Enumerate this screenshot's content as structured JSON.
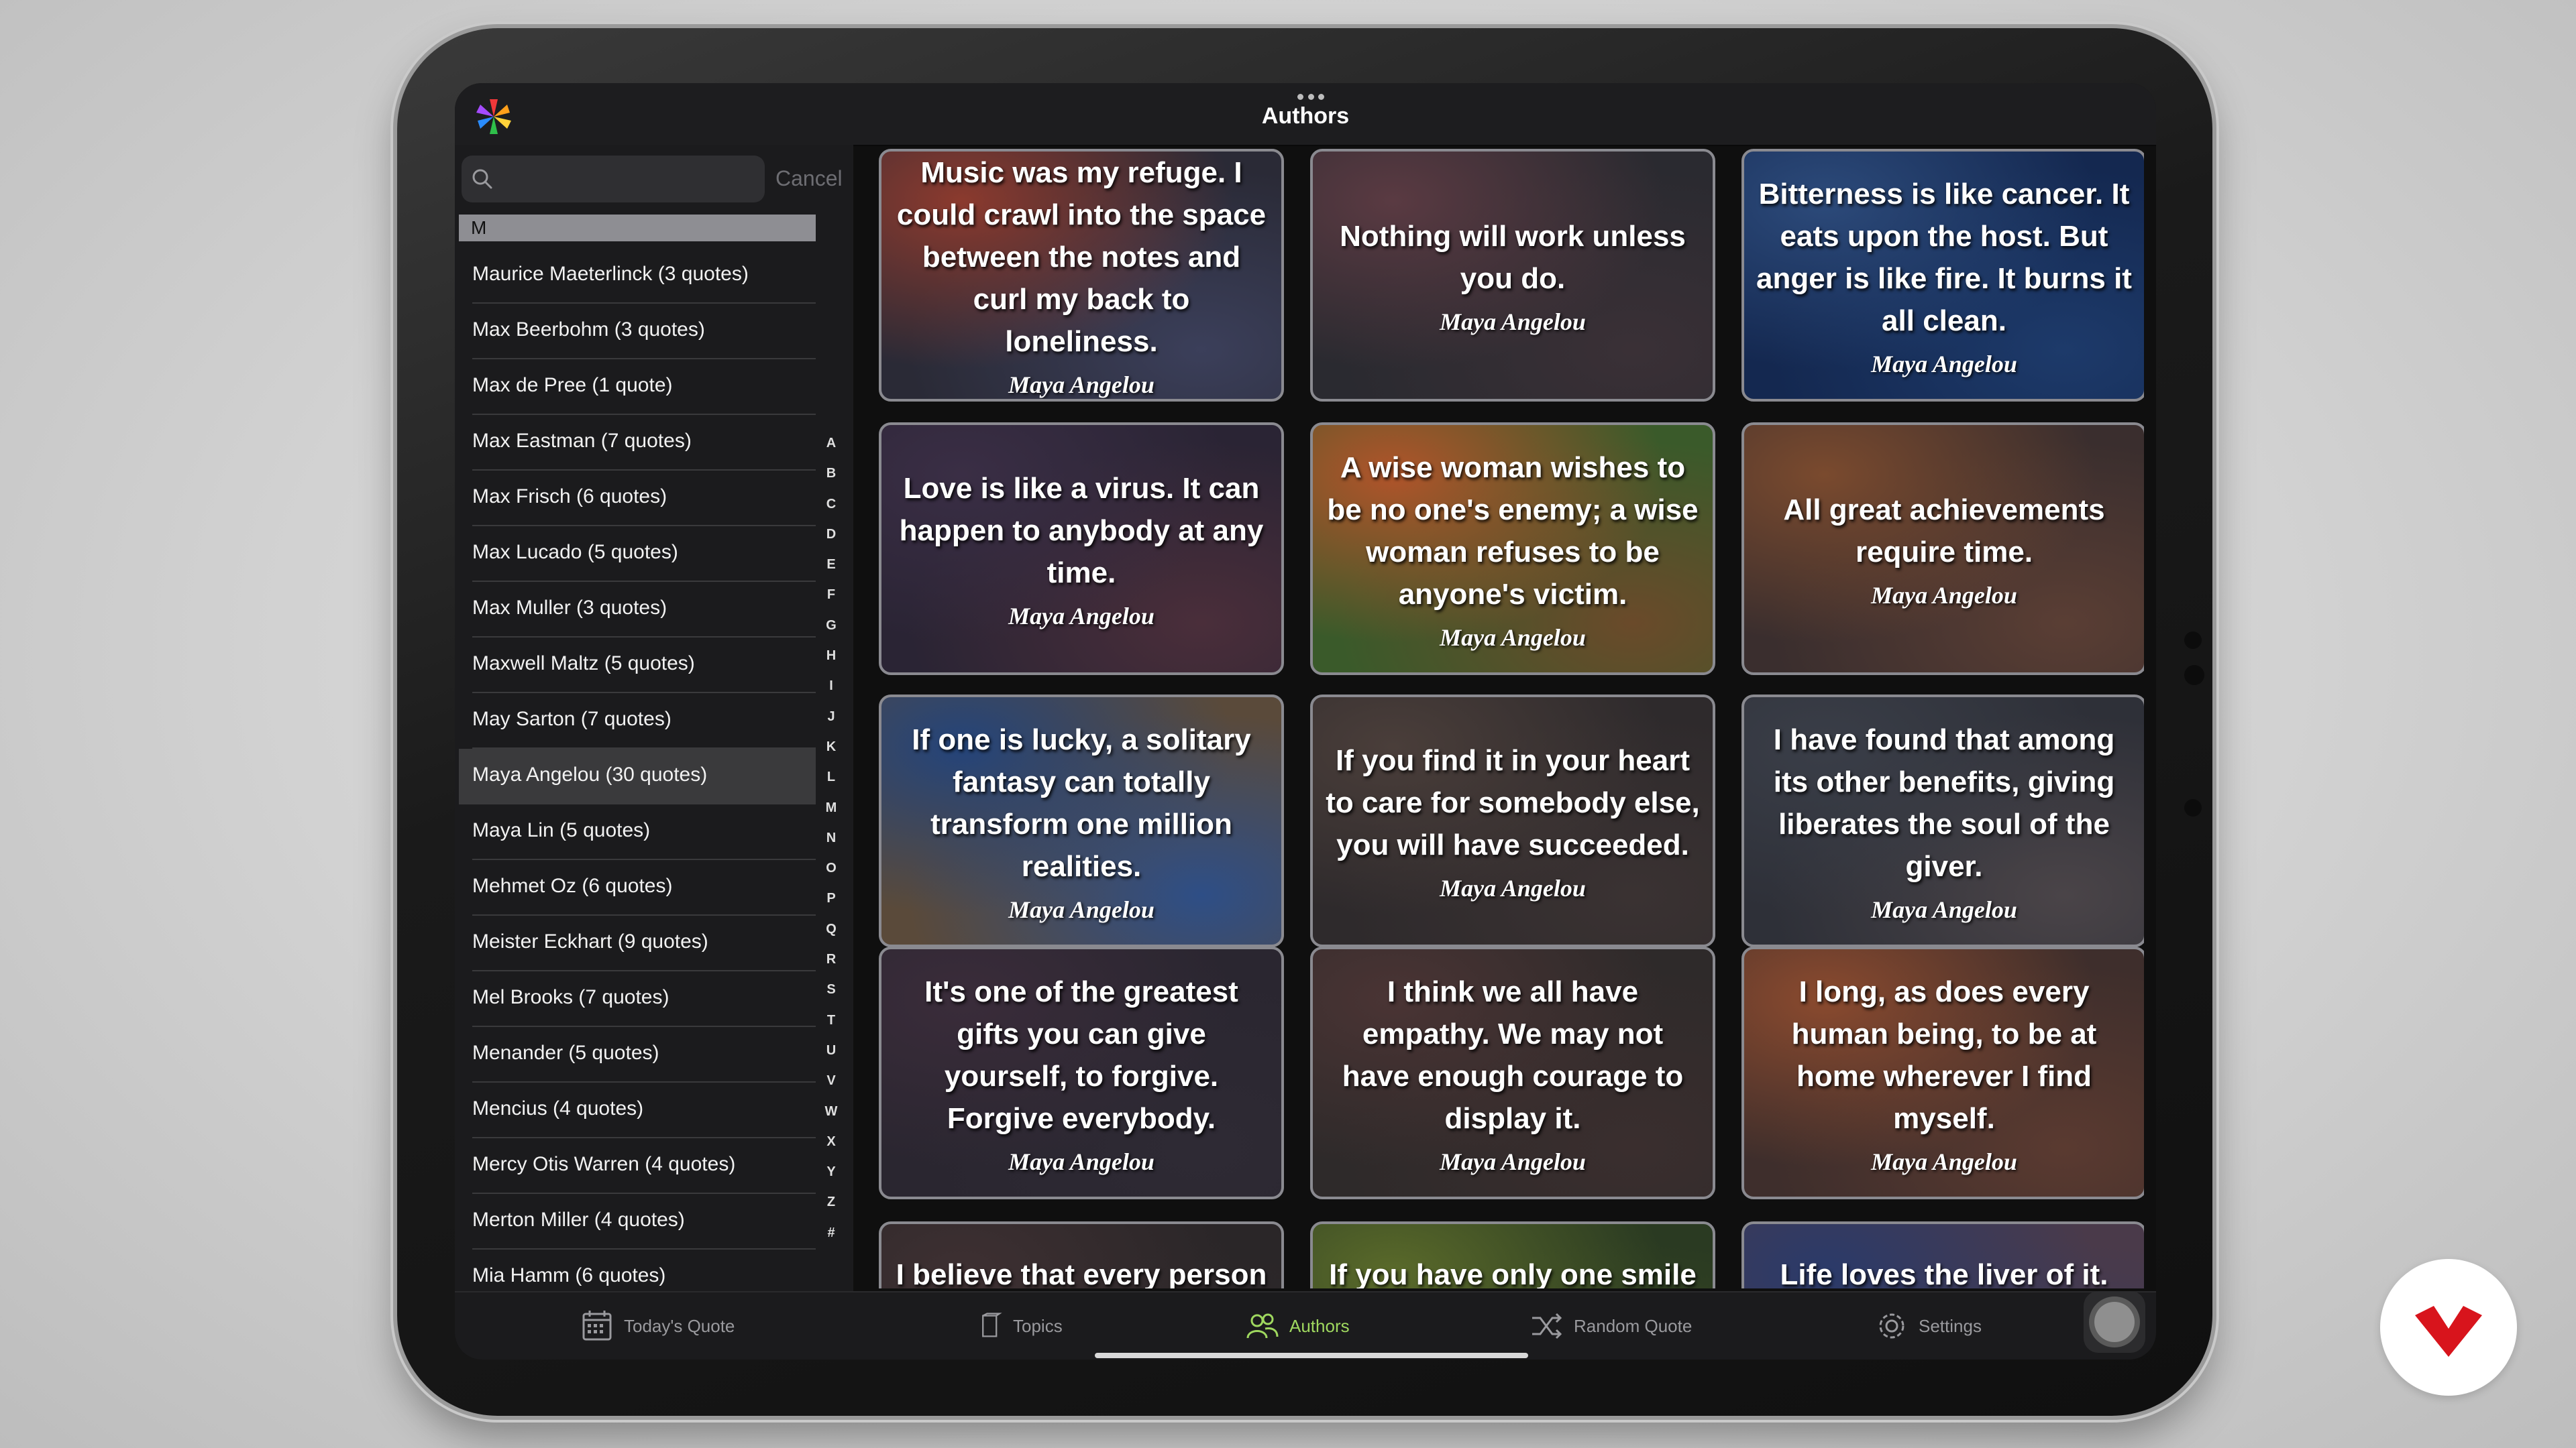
{
  "app": {
    "title": "Authors"
  },
  "search": {
    "placeholder": "",
    "cancel_label": "Cancel"
  },
  "section": {
    "header": "M"
  },
  "authors": [
    {
      "label": "Maurice Maeterlinck (3 quotes)",
      "selected": false
    },
    {
      "label": "Max Beerbohm (3 quotes)",
      "selected": false
    },
    {
      "label": "Max de Pree (1 quote)",
      "selected": false
    },
    {
      "label": "Max Eastman (7 quotes)",
      "selected": false
    },
    {
      "label": "Max Frisch (6 quotes)",
      "selected": false
    },
    {
      "label": "Max Lucado (5 quotes)",
      "selected": false
    },
    {
      "label": "Max Muller (3 quotes)",
      "selected": false
    },
    {
      "label": "Maxwell Maltz (5 quotes)",
      "selected": false
    },
    {
      "label": "May Sarton (7 quotes)",
      "selected": false
    },
    {
      "label": "Maya Angelou (30 quotes)",
      "selected": true
    },
    {
      "label": "Maya Lin (5 quotes)",
      "selected": false
    },
    {
      "label": "Mehmet Oz (6 quotes)",
      "selected": false
    },
    {
      "label": "Meister Eckhart (9 quotes)",
      "selected": false
    },
    {
      "label": "Mel Brooks (7 quotes)",
      "selected": false
    },
    {
      "label": "Menander (5 quotes)",
      "selected": false
    },
    {
      "label": "Mencius (4 quotes)",
      "selected": false
    },
    {
      "label": "Mercy Otis Warren (4 quotes)",
      "selected": false
    },
    {
      "label": "Merton Miller (4 quotes)",
      "selected": false
    },
    {
      "label": "Mia Hamm (6 quotes)",
      "selected": false
    }
  ],
  "index_letters": [
    "A",
    "B",
    "C",
    "D",
    "E",
    "F",
    "G",
    "H",
    "I",
    "J",
    "K",
    "L",
    "M",
    "N",
    "O",
    "P",
    "Q",
    "R",
    "S",
    "T",
    "U",
    "V",
    "W",
    "X",
    "Y",
    "Z",
    "#"
  ],
  "quotes": [
    {
      "text": "Music was my refuge. I could crawl into the space between the notes and curl my back to loneliness.",
      "author": "Maya Angelou",
      "bg": [
        "#8b3a2e",
        "#3b3f5a",
        "#2a2a36"
      ]
    },
    {
      "text": "Nothing will work unless you do.",
      "author": "Maya Angelou",
      "bg": [
        "#5a3a42",
        "#3a3036",
        "#2a2a30"
      ]
    },
    {
      "text": "Bitterness is like cancer. It eats upon the host. But anger is like fire. It burns it all clean.",
      "author": "Maya Angelou",
      "bg": [
        "#2c4a7a",
        "#1d3a6a",
        "#142850"
      ]
    },
    {
      "text": "Love is like a virus. It can happen to anybody at any time.",
      "author": "Maya Angelou",
      "bg": [
        "#3a2e45",
        "#4a2e3a",
        "#2a2434"
      ]
    },
    {
      "text": "A wise woman wishes to be no one's enemy; a wise woman refuses to be anyone's victim.",
      "author": "Maya Angelou",
      "bg": [
        "#b0542a",
        "#6a4a2a",
        "#3a5a2a"
      ]
    },
    {
      "text": "All great achievements require time.",
      "author": "Maya Angelou",
      "bg": [
        "#7a4a2e",
        "#5a3e34",
        "#3a2e2e"
      ]
    },
    {
      "text": "If one is lucky, a solitary fantasy can totally transform one million realities.",
      "author": "Maya Angelou",
      "bg": [
        "#24447a",
        "#2e4e86",
        "#5a4a3a"
      ]
    },
    {
      "text": "If you find it in your heart to care for somebody else, you will have succeeded.",
      "author": "Maya Angelou",
      "bg": [
        "#4a3e3a",
        "#3a3232",
        "#2e2a2c"
      ]
    },
    {
      "text": "I have found that among its other benefits, giving liberates the soul of the giver.",
      "author": "Maya Angelou",
      "bg": [
        "#3a3e48",
        "#4a4448",
        "#2e3038"
      ]
    },
    {
      "text": "It's one of the greatest gifts you can give yourself, to forgive. Forgive everybody.",
      "author": "Maya Angelou",
      "bg": [
        "#3a2c3a",
        "#2e2a34",
        "#2a2630"
      ]
    },
    {
      "text": "I think we all have empathy. We may not have enough courage to display it.",
      "author": "Maya Angelou",
      "bg": [
        "#4a3434",
        "#3a2e2e",
        "#2e2a2a"
      ]
    },
    {
      "text": "I long, as does every human being, to be at home wherever I find myself.",
      "author": "Maya Angelou",
      "bg": [
        "#8a4a2e",
        "#5a3a30",
        "#3e2e2c"
      ]
    },
    {
      "text": "I believe that every person is born with talent.",
      "author": "",
      "bg": [
        "#3e3032",
        "#302a2c",
        "#2a2628"
      ]
    },
    {
      "text": "If you have only one smile in you give it to the people you love.",
      "author": "",
      "bg": [
        "#5a6a2a",
        "#3a4a22",
        "#2a3a22"
      ]
    },
    {
      "text": "Life loves the liver of it.",
      "author": "",
      "bg": [
        "#2a3a6a",
        "#3a3a5a",
        "#4a3a4a"
      ]
    }
  ],
  "tabs": [
    {
      "label": "Today's Quote",
      "icon": "calendar-icon",
      "active": false
    },
    {
      "label": "Topics",
      "icon": "book-icon",
      "active": false
    },
    {
      "label": "Authors",
      "icon": "people-icon",
      "active": true
    },
    {
      "label": "Random Quote",
      "icon": "shuffle-icon",
      "active": false
    },
    {
      "label": "Settings",
      "icon": "gear-icon",
      "active": false
    }
  ],
  "colors": {
    "accent": "#9fd85f",
    "watermark": "#d8141c"
  }
}
